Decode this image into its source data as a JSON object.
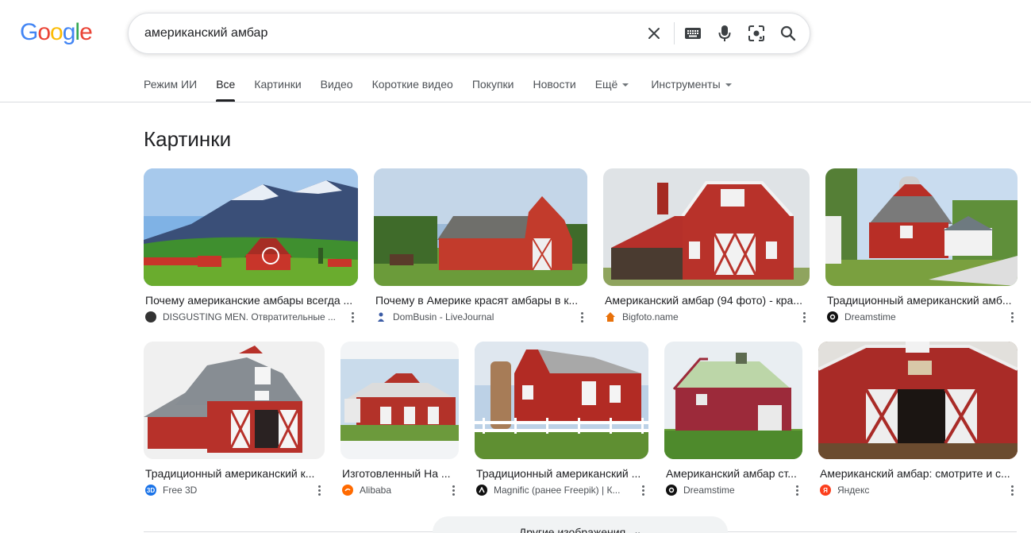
{
  "logo": {
    "letters": [
      "G",
      "o",
      "o",
      "g",
      "l",
      "e"
    ],
    "colors": [
      "#4285F4",
      "#EA4335",
      "#FBBC05",
      "#4285F4",
      "#34A853",
      "#EA4335"
    ]
  },
  "search": {
    "query": "американский амбар"
  },
  "tabs": [
    {
      "label": "Режим ИИ"
    },
    {
      "label": "Все"
    },
    {
      "label": "Картинки"
    },
    {
      "label": "Видео"
    },
    {
      "label": "Короткие видео"
    },
    {
      "label": "Покупки"
    },
    {
      "label": "Новости"
    },
    {
      "label": "Ещё"
    },
    {
      "label": "Инструменты"
    }
  ],
  "section": {
    "title": "Картинки"
  },
  "images": [
    {
      "title": "Почему американские амбары всегда ...",
      "source": "DISGUSTING MEN. Отвратительные ...",
      "favicon": "face-icon",
      "fav_color": "#333333"
    },
    {
      "title": "Почему в Америке красят амбары в к...",
      "source": "DomBusin - LiveJournal",
      "favicon": "person-icon",
      "fav_color": "#3b5ba5"
    },
    {
      "title": "Американский амбар (94 фото) - кра...",
      "source": "Bigfoto.name",
      "favicon": "house-icon",
      "fav_color": "#e8710a"
    },
    {
      "title": "Традиционный американский амб...",
      "source": "Dreamstime",
      "favicon": "dreamstime-icon",
      "fav_color": "#111111"
    },
    {
      "title": "Традиционный американский к...",
      "source": "Free 3D",
      "favicon": "free3d-icon",
      "fav_color": "#1a73e8",
      "fav_text": "3D"
    },
    {
      "title": "Изготовленный На ...",
      "source": "Alibaba",
      "favicon": "alibaba-icon",
      "fav_color": "#ff6a00"
    },
    {
      "title": "Традиционный американский ...",
      "source": "Magnific (ранее Freepik) | К...",
      "favicon": "magnific-icon",
      "fav_color": "#111111"
    },
    {
      "title": "Американский амбар ст...",
      "source": "Dreamstime",
      "favicon": "dreamstime-icon",
      "fav_color": "#111111"
    },
    {
      "title": "Американский амбар: смотрите и с...",
      "source": "Яндекс",
      "favicon": "yandex-icon",
      "fav_color": "#fc3f1d",
      "fav_text": "Я"
    }
  ],
  "more": {
    "label": "Другие изображения"
  }
}
